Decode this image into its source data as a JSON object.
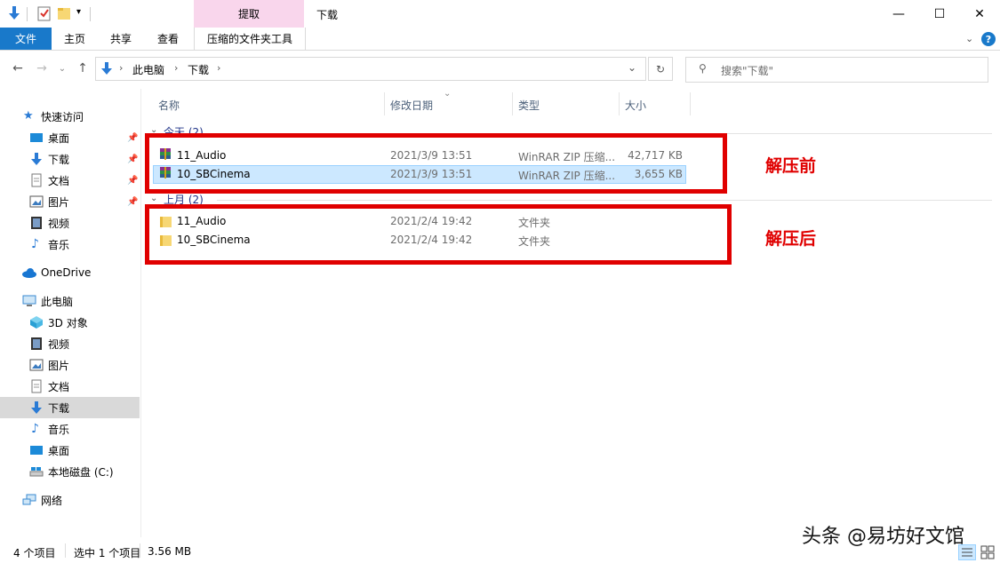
{
  "window": {
    "context_tab_header": "提取",
    "title": "下载",
    "minimize": "—",
    "maximize": "☐",
    "close": "✕"
  },
  "ribbon": {
    "tabs": [
      "文件",
      "主页",
      "共享",
      "查看",
      "压缩的文件夹工具"
    ]
  },
  "address": {
    "breadcrumb": [
      "此电脑",
      "下载"
    ],
    "search_placeholder": "搜索\"下载\""
  },
  "sidebar": {
    "quick_access": "快速访问",
    "quick_items": [
      "桌面",
      "下载",
      "文档",
      "图片",
      "视频",
      "音乐"
    ],
    "onedrive": "OneDrive",
    "this_pc": "此电脑",
    "pc_items": [
      "3D 对象",
      "视频",
      "图片",
      "文档",
      "下载",
      "音乐",
      "桌面",
      "本地磁盘 (C:)"
    ],
    "network": "网络"
  },
  "columns": {
    "name": "名称",
    "date": "修改日期",
    "type": "类型",
    "size": "大小"
  },
  "groups": [
    {
      "header": "今天 (2)",
      "files": [
        {
          "name": "11_Audio",
          "date": "2021/3/9 13:51",
          "type": "WinRAR ZIP 压缩...",
          "size": "42,717 KB"
        },
        {
          "name": "10_SBCinema",
          "date": "2021/3/9 13:51",
          "type": "WinRAR ZIP 压缩...",
          "size": "3,655 KB"
        }
      ]
    },
    {
      "header": "上月 (2)",
      "files": [
        {
          "name": "11_Audio",
          "date": "2021/2/4 19:42",
          "type": "文件夹",
          "size": ""
        },
        {
          "name": "10_SBCinema",
          "date": "2021/2/4 19:42",
          "type": "文件夹",
          "size": ""
        }
      ]
    }
  ],
  "annotations": {
    "before": "解压前",
    "after": "解压后"
  },
  "status": {
    "count": "4 个项目",
    "selection": "选中 1 个项目",
    "selection_size": "3.56 MB"
  },
  "watermark": "头条 @易坊好文馆",
  "colors": {
    "accent": "#1979ca",
    "context_tab": "#f9d6ec",
    "selection": "#cce8ff",
    "annotation_red": "#e00000"
  }
}
